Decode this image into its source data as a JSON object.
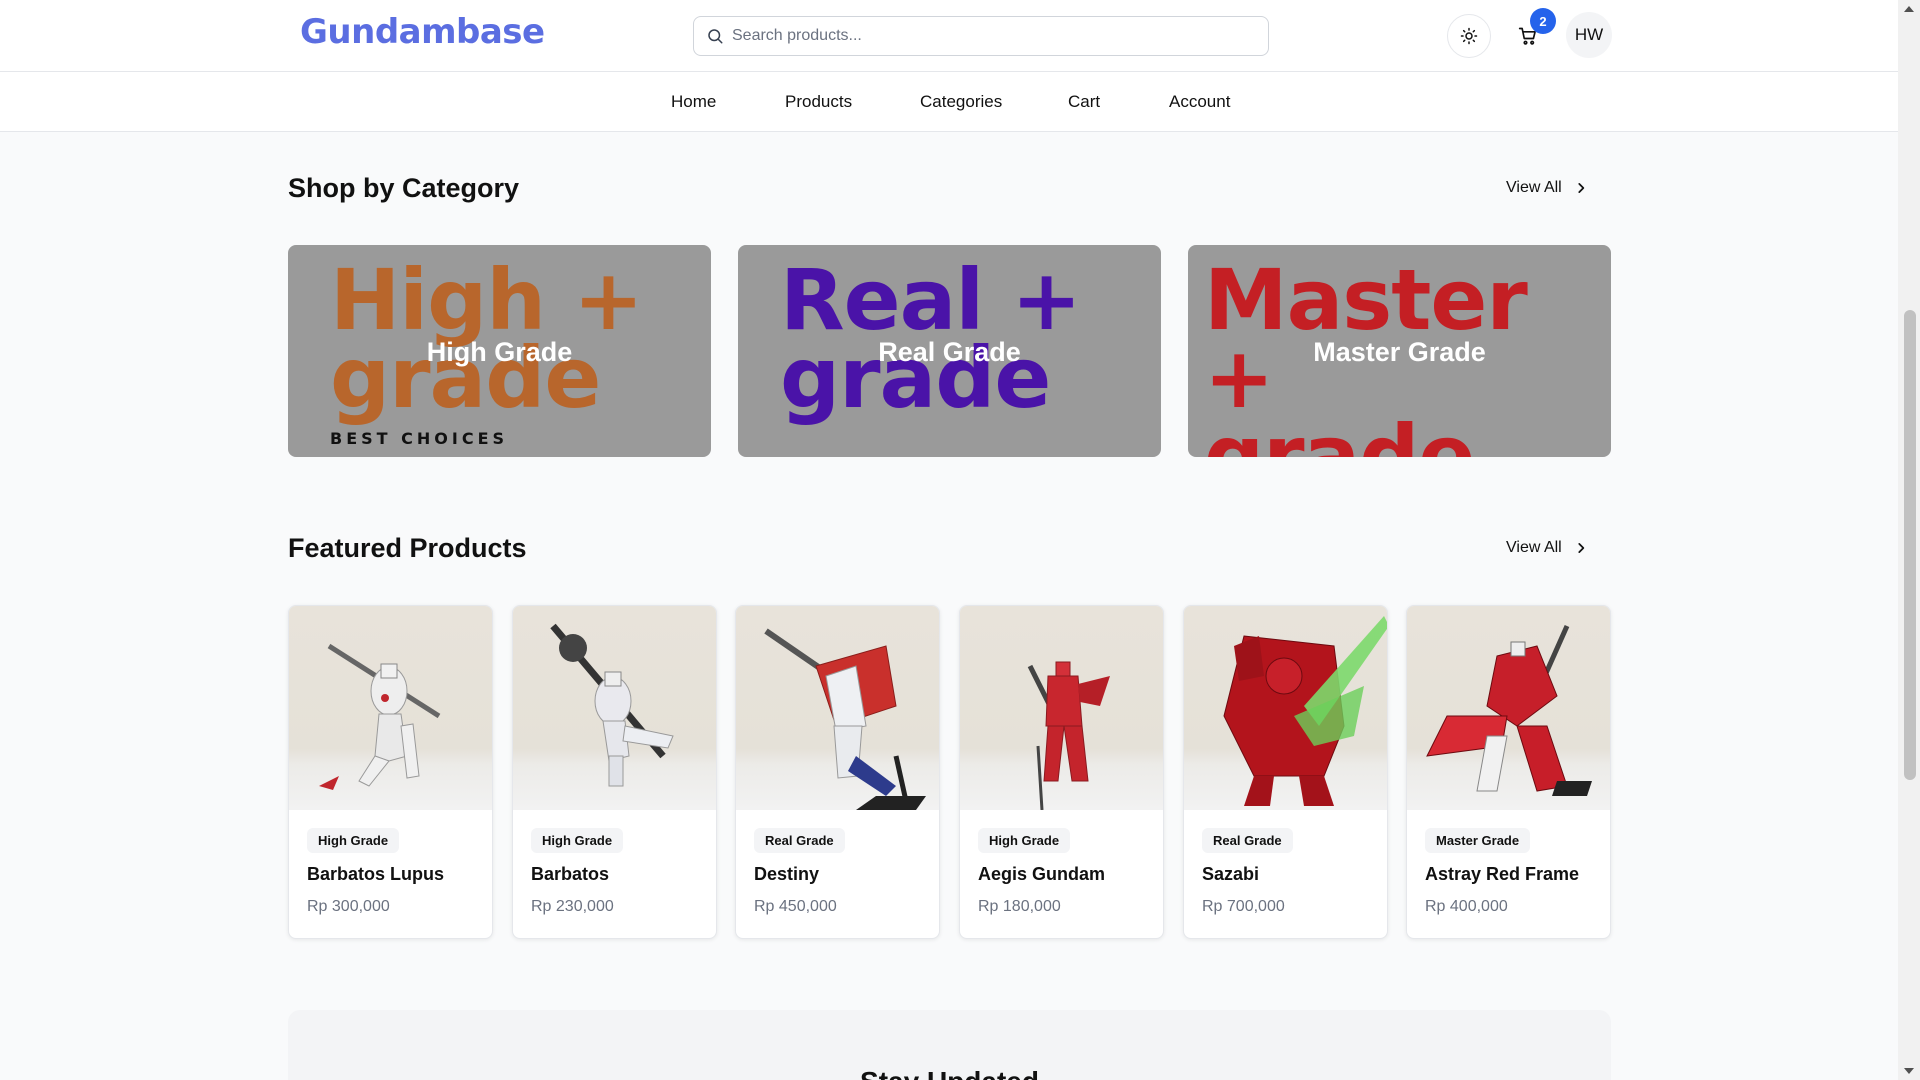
{
  "header": {
    "logo": "Gundambase",
    "search_placeholder": "Search products...",
    "cart_count": "2",
    "avatar_initials": "HW",
    "icons": {
      "search": "search-icon",
      "theme": "sun-icon",
      "cart": "cart-icon"
    }
  },
  "nav": {
    "items": [
      "Home",
      "Products",
      "Categories",
      "Cart",
      "Account"
    ]
  },
  "categories_section": {
    "title": "Shop by Category",
    "view_all": "View All",
    "cards": [
      {
        "label": "High Grade",
        "art_line1": "High +",
        "art_line2": "grade",
        "art_sub": "BEST CHOICES",
        "art_color": "#b8662c"
      },
      {
        "label": "Real Grade",
        "art_line1": "Real +",
        "art_line2": "grade",
        "art_sub": "",
        "art_color": "#4a13a8"
      },
      {
        "label": "Master Grade",
        "art_line1": "Master +",
        "art_line2": "grade",
        "art_sub": "",
        "art_color": "#c41f24"
      }
    ]
  },
  "featured_section": {
    "title": "Featured Products",
    "view_all": "View All",
    "products": [
      {
        "grade": "High Grade",
        "name": "Barbatos Lupus",
        "price": "Rp 300,000"
      },
      {
        "grade": "High Grade",
        "name": "Barbatos",
        "price": "Rp 230,000"
      },
      {
        "grade": "Real Grade",
        "name": "Destiny",
        "price": "Rp 450,000"
      },
      {
        "grade": "High Grade",
        "name": "Aegis Gundam",
        "price": "Rp 180,000"
      },
      {
        "grade": "Real Grade",
        "name": "Sazabi",
        "price": "Rp 700,000"
      },
      {
        "grade": "Master Grade",
        "name": "Astray Red Frame",
        "price": "Rp 400,000"
      }
    ]
  },
  "newsletter": {
    "title": "Stay Updated"
  },
  "colors": {
    "brand": "#5b6ee1",
    "badge": "#2563eb"
  }
}
